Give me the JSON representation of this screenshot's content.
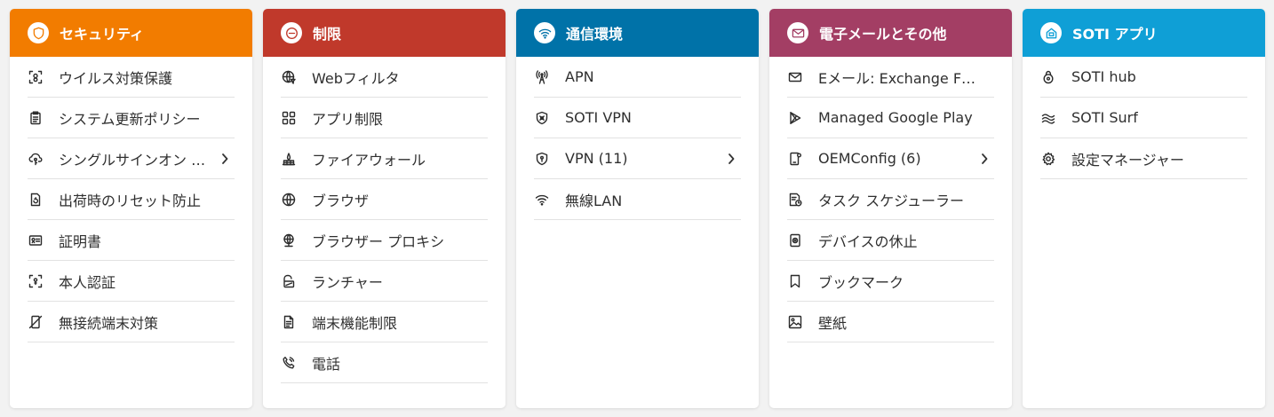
{
  "cards": [
    {
      "title": "セキュリティ",
      "color": "#f27c00",
      "icon": "shield-icon",
      "items": [
        {
          "label": "ウイルス対策保護",
          "icon": "scan-face-icon"
        },
        {
          "label": "システム更新ポリシー",
          "icon": "clipboard-icon"
        },
        {
          "label": "シングルサインオン …",
          "icon": "cloud-key-icon",
          "has_submenu": true
        },
        {
          "label": "出荷時のリセット防止",
          "icon": "reset-icon"
        },
        {
          "label": "証明書",
          "icon": "certificate-icon"
        },
        {
          "label": "本人認証",
          "icon": "identity-scan-icon"
        },
        {
          "label": "無接続端末対策",
          "icon": "device-disconnected-icon"
        }
      ]
    },
    {
      "title": "制限",
      "color": "#c0392b",
      "icon": "minus-circle-icon",
      "items": [
        {
          "label": "Webフィルタ",
          "icon": "globe-filter-icon"
        },
        {
          "label": "アプリ制限",
          "icon": "apps-grid-icon"
        },
        {
          "label": "ファイアウォール",
          "icon": "firewall-icon"
        },
        {
          "label": "ブラウザ",
          "icon": "globe-icon"
        },
        {
          "label": "ブラウザー プロキシ",
          "icon": "globe-proxy-icon"
        },
        {
          "label": "ランチャー",
          "icon": "launcher-icon"
        },
        {
          "label": "端末機能制限",
          "icon": "device-features-icon"
        },
        {
          "label": "電話",
          "icon": "phone-icon"
        }
      ]
    },
    {
      "title": "通信環境",
      "color": "#0072a8",
      "icon": "wifi-icon",
      "items": [
        {
          "label": "APN",
          "icon": "antenna-icon"
        },
        {
          "label": "SOTI VPN",
          "icon": "soti-vpn-shield-icon"
        },
        {
          "label": "VPN (11)",
          "icon": "vpn-shield-icon",
          "has_submenu": true
        },
        {
          "label": "無線LAN",
          "icon": "wifi-icon"
        }
      ]
    },
    {
      "title": "電子メールとその他",
      "color": "#a33e64",
      "icon": "mail-icon",
      "items": [
        {
          "label": "Eメール: Exchange F…",
          "icon": "mail-icon"
        },
        {
          "label": "Managed Google Play",
          "icon": "play-icon"
        },
        {
          "label": "OEMConfig (6)",
          "icon": "device-config-icon",
          "has_submenu": true
        },
        {
          "label": "タスク スケジューラー",
          "icon": "task-schedule-icon"
        },
        {
          "label": "デバイスの休止",
          "icon": "device-pause-icon"
        },
        {
          "label": "ブックマーク",
          "icon": "bookmark-icon"
        },
        {
          "label": "壁紙",
          "icon": "image-icon"
        }
      ]
    },
    {
      "title": "SOTI アプリ",
      "color": "#0f9fd6",
      "icon": "soti-app-icon",
      "items": [
        {
          "label": "SOTI hub",
          "icon": "soti-hub-icon"
        },
        {
          "label": "SOTI Surf",
          "icon": "soti-surf-icon"
        },
        {
          "label": "設定マネージャー",
          "icon": "settings-gear-icon"
        }
      ]
    }
  ]
}
